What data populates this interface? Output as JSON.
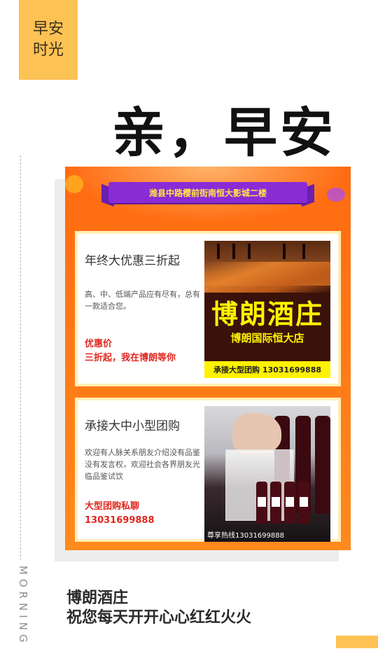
{
  "badge": {
    "line1": "早安",
    "line2": "时光"
  },
  "headline": "亲，早安",
  "side_text": "MORNING",
  "poster": {
    "ribbon": "潍县中路樱前街南恒大影城二楼",
    "card1": {
      "title": "年终大优惠三折起",
      "desc": "高、中、低端产品应有尽有，总有一款适合您。",
      "red1": "优惠价",
      "red2": "三折起，我在博朗等你",
      "image": {
        "name": "博朗酒庄",
        "sub": "博朗国际恒大店",
        "bar": "承接大型团购  13031699888"
      }
    },
    "card2": {
      "title": "承接大中小型团购",
      "desc": "欢迎有人脉关系朋友介绍没有品鉴没有发言权，欢迎社会各界朋友光临品鉴试饮",
      "red1": "大型团购私聊",
      "red2": "13031699888",
      "image": {
        "footer": "尊享热线13031699888"
      }
    }
  },
  "footer": {
    "line1": "博朗酒庄",
    "line2": "祝您每天开开心心红红火火"
  },
  "colors": {
    "accent": "#fdc254",
    "poster_orange": "#ff7a16",
    "ribbon_purple": "#8a2bd6",
    "highlight_yellow": "#fff200",
    "price_red": "#e2261e"
  }
}
